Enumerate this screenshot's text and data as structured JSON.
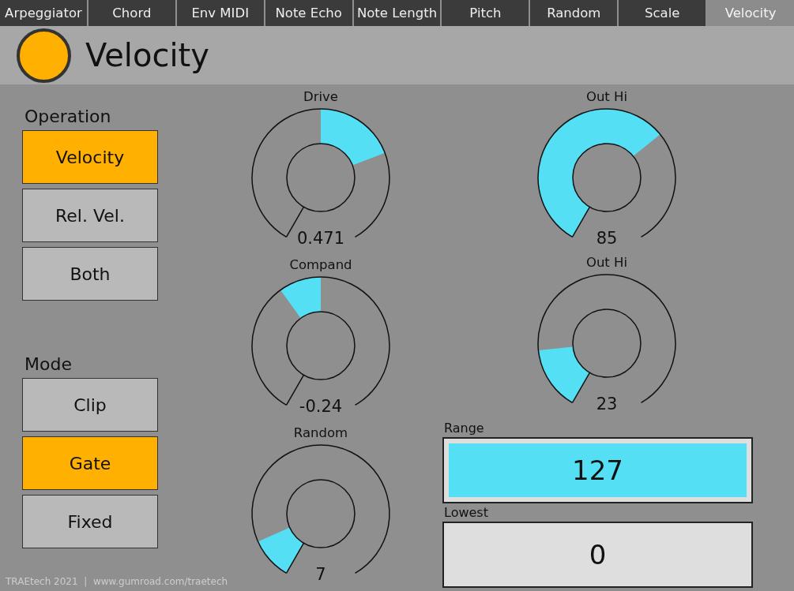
{
  "tabs": [
    {
      "label": "Arpeggiator",
      "selected": false
    },
    {
      "label": "Chord",
      "selected": false
    },
    {
      "label": "Env MIDI",
      "selected": false
    },
    {
      "label": "Note Echo",
      "selected": false
    },
    {
      "label": "Note Length",
      "selected": false
    },
    {
      "label": "Pitch",
      "selected": false
    },
    {
      "label": "Random",
      "selected": false
    },
    {
      "label": "Scale",
      "selected": false
    },
    {
      "label": "Velocity",
      "selected": true
    }
  ],
  "header": {
    "title": "Velocity"
  },
  "operation": {
    "label": "Operation",
    "buttons": [
      {
        "label": "Velocity",
        "selected": true
      },
      {
        "label": "Rel. Vel.",
        "selected": false
      },
      {
        "label": "Both",
        "selected": false
      }
    ]
  },
  "mode": {
    "label": "Mode",
    "buttons": [
      {
        "label": "Clip",
        "selected": false
      },
      {
        "label": "Gate",
        "selected": true
      },
      {
        "label": "Fixed",
        "selected": false
      }
    ]
  },
  "knobs_left": [
    {
      "label": "Drive",
      "reading": "0.471",
      "kind": "bipolar"
    },
    {
      "label": "Compand",
      "reading": "-0.24",
      "kind": "bipolar"
    },
    {
      "label": "Random",
      "reading": "7",
      "kind": "unipolar"
    }
  ],
  "knobs_right": [
    {
      "label": "Out Hi",
      "reading": "85",
      "kind": "unipolar"
    },
    {
      "label": "Out Hi",
      "reading": "23",
      "kind": "unipolar"
    }
  ],
  "range": {
    "label": "Range",
    "value": "127"
  },
  "lowest": {
    "label": "Lowest",
    "value": "0"
  },
  "footer": "TRAEtech 2021  |  www.gumroad.com/traetech"
}
